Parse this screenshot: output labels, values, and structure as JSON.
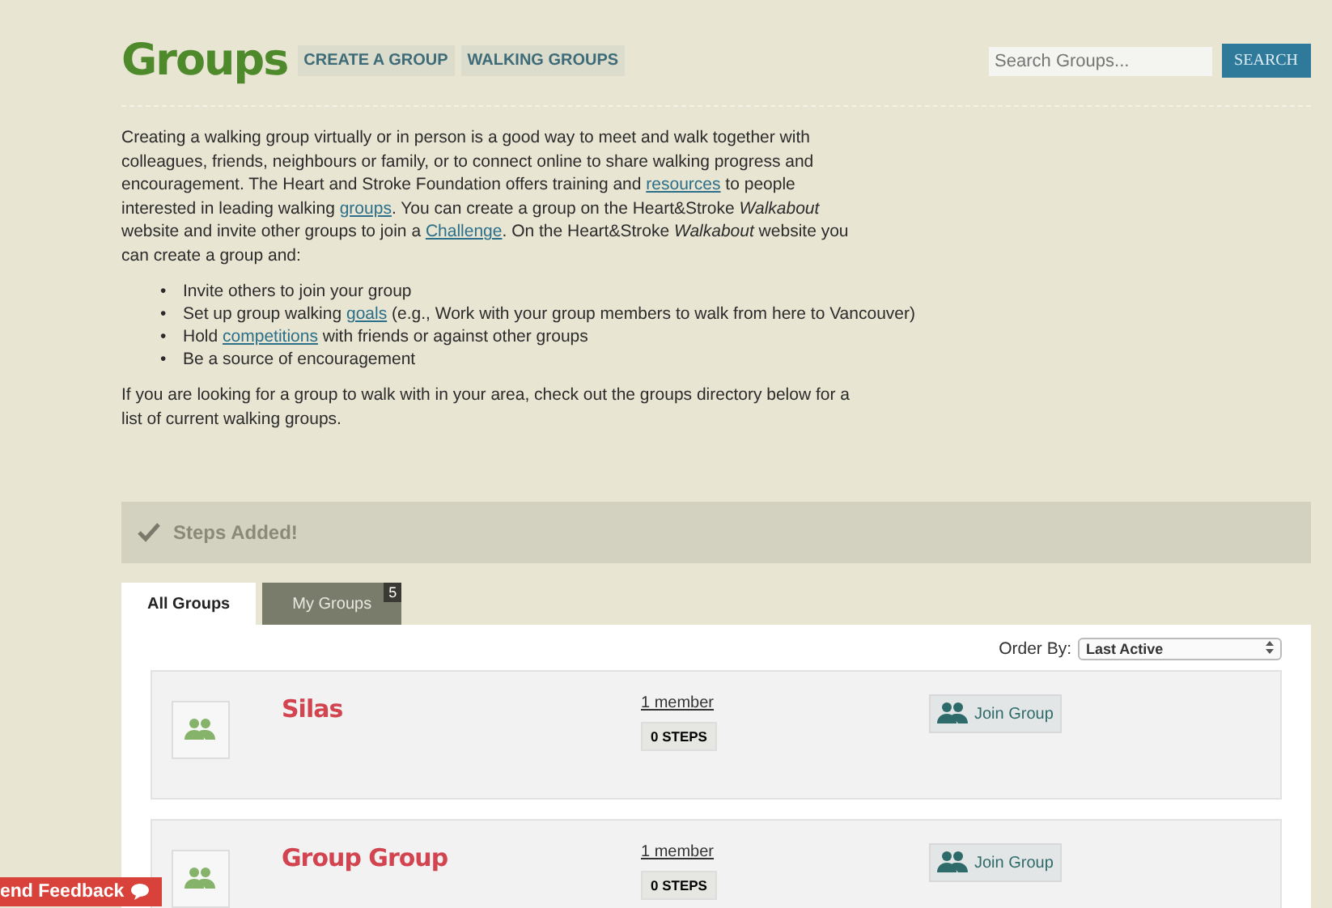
{
  "header": {
    "title": "Groups",
    "nav": [
      "CREATE A GROUP",
      "WALKING GROUPS"
    ],
    "search": {
      "placeholder": "Search Groups...",
      "button": "SEARCH"
    }
  },
  "intro": [
    {
      "kind": "text",
      "text": "Creating a walking group virtually or in person is a good way to meet and walk together with colleagues, friends, neighbours or family, or to connect online to share walking progress and encouragement. The Heart and Stroke Foundation offers training and "
    },
    {
      "kind": "link",
      "text": "resources"
    },
    {
      "kind": "text",
      "text": " to people interested in leading walking "
    },
    {
      "kind": "link",
      "text": "groups"
    },
    {
      "kind": "text",
      "text": ". You can create a group on the Heart&Stroke *Walkabout* website and invite other groups to join a "
    },
    {
      "kind": "link",
      "text": "Challenge"
    },
    {
      "kind": "text",
      "text": ". On the Heart&Stroke *Walkabout* website you can create a group and:"
    }
  ],
  "bullets": [
    {
      "marker": "•",
      "parts": [
        {
          "kind": "text",
          "text": "Invite others to join your group"
        }
      ]
    },
    {
      "marker": "•",
      "parts": [
        {
          "kind": "text",
          "text": "Set up group walking "
        },
        {
          "kind": "link",
          "text": "goals"
        },
        {
          "kind": "text",
          "text": " (e.g., Work with your group members to walk from here to Vancouver)"
        }
      ]
    },
    {
      "marker": "•",
      "parts": [
        {
          "kind": "text",
          "text": "Hold "
        },
        {
          "kind": "link",
          "text": "competitions"
        },
        {
          "kind": "text",
          "text": " with friends or against other groups"
        }
      ]
    },
    {
      "marker": "•",
      "parts": [
        {
          "kind": "text",
          "text": "Be a source of encouragement"
        }
      ]
    }
  ],
  "outro": "If you are looking for a group to walk with in your area, check out the groups directory below for a list of current walking groups.",
  "notice": "Steps Added!",
  "tabs": [
    {
      "label": "All Groups",
      "selected": true
    },
    {
      "label": "My Groups",
      "selected": false,
      "badge": "5"
    }
  ],
  "order_by": {
    "label": "Order By:",
    "value": "Last Active"
  },
  "groups": [
    {
      "name": "Silas",
      "members": "1 member",
      "steps": "0 STEPS",
      "action": "Join Group"
    },
    {
      "name": "Group Group",
      "members": "1 member",
      "steps": "0 STEPS",
      "action": "Join Group"
    }
  ],
  "feedback_button": "end Feedback"
}
